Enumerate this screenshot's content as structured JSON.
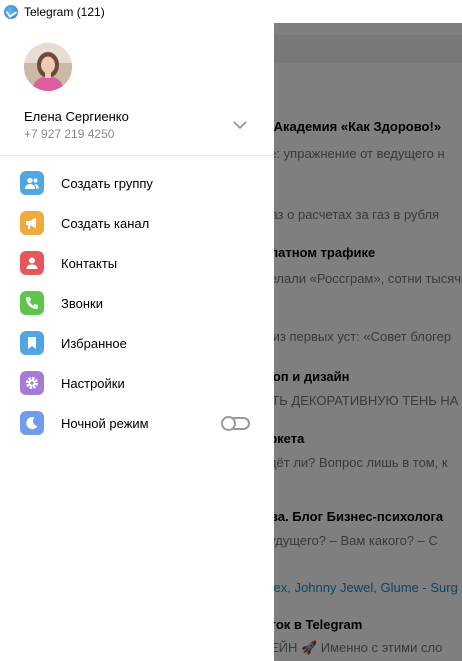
{
  "window": {
    "title": "Telegram (121)"
  },
  "chat_list_background": {
    "lines": [
      {
        "text": "и Академия «Как Здорово!»",
        "style": "bold"
      },
      {
        "text": "ре: упражнение от ведущего н",
        "style": "preview"
      },
      {
        "text": "указ о расчетах за газ в рубля",
        "style": "preview"
      },
      {
        "text": "платном трафике",
        "style": "bold"
      },
      {
        "text": "делали «Россграм», сотни тысяч",
        "style": "preview"
      },
      {
        "text": "я из первых уст: «Совет блогер",
        "style": "preview"
      },
      {
        "text": "шоп и дизайн",
        "style": "bold"
      },
      {
        "text": "ИТЬ ДЕКОРАТИВНУЮ ТЕНЬ НА С",
        "style": "preview"
      },
      {
        "text": "аркета",
        "style": "bold"
      },
      {
        "text": "едёт ли? Вопрос лишь в том, к",
        "style": "preview"
      },
      {
        "text": "ова. Блог Бизнес-психолога",
        "style": "bold"
      },
      {
        "text": "будущего?  – Вам какого?  – С",
        "style": "preview"
      },
      {
        "text": "Plex, Johnny Jewel, Glume - Surg",
        "style": "link"
      },
      {
        "text": "оток в Telegram",
        "style": "bold"
      },
      {
        "text": "ТЕЙН 🚀 Именно с этими сло",
        "style": "preview"
      }
    ]
  },
  "drawer": {
    "user": {
      "name": "Елена Сергиенко",
      "phone": "+7 927 219 4250"
    },
    "menu": [
      {
        "label": "Создать группу",
        "icon": "group-icon",
        "color": "#50a6e3"
      },
      {
        "label": "Создать канал",
        "icon": "megaphone-icon",
        "color": "#f0a93b"
      },
      {
        "label": "Контакты",
        "icon": "contact-icon",
        "color": "#e5575a"
      },
      {
        "label": "Звонки",
        "icon": "phone-icon",
        "color": "#5cc54a"
      },
      {
        "label": "Избранное",
        "icon": "bookmark-icon",
        "color": "#50a6e3"
      },
      {
        "label": "Настройки",
        "icon": "gear-icon",
        "color": "#a17cd8"
      },
      {
        "label": "Ночной режим",
        "icon": "moon-icon",
        "color": "#6f9bf0",
        "toggle": false
      }
    ]
  }
}
